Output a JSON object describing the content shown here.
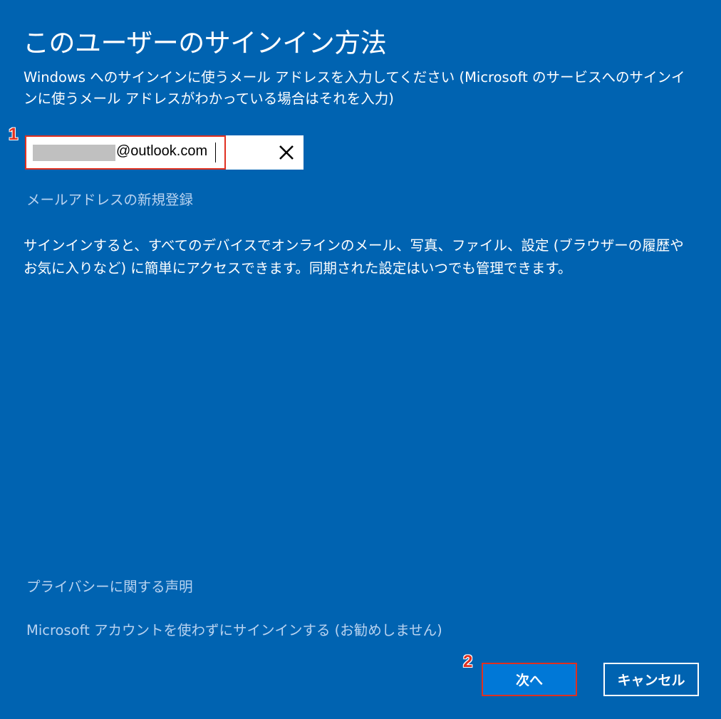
{
  "title": "このユーザーのサインイン方法",
  "instruction": "Windows へのサインインに使うメール アドレスを入力してください (Microsoft のサービスへのサインインに使うメール アドレスがわかっている場合はそれを入力)",
  "email_input": {
    "value": "@outlook.com",
    "clear_icon": "close-icon"
  },
  "new_email_link": "メールアドレスの新規登録",
  "body_text": "サインインすると、すべてのデバイスでオンラインのメール、写真、ファイル、設定 (ブラウザーの履歴やお気に入りなど) に簡単にアクセスできます。同期された設定はいつでも管理できます。",
  "privacy_link": "プライバシーに関する声明",
  "no_account_link": "Microsoft アカウントを使わずにサインインする (お勧めしません)",
  "buttons": {
    "next": "次へ",
    "cancel": "キャンセル"
  },
  "annotations": {
    "step1": "1",
    "step2": "2"
  },
  "colors": {
    "background": "#0063b1",
    "primary_button": "#0078d7",
    "highlight": "#e03020",
    "link": "#b9d3f0"
  }
}
